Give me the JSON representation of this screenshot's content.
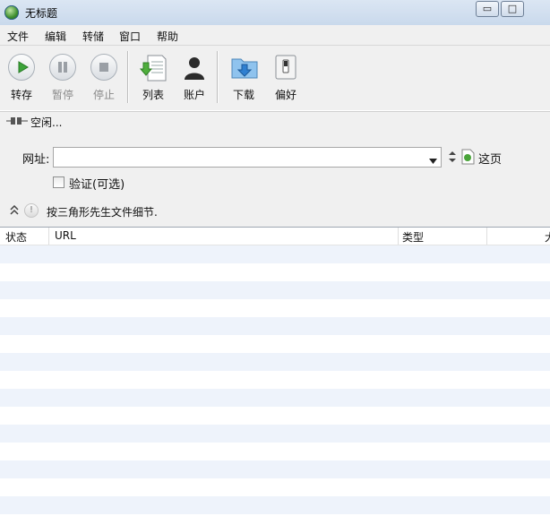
{
  "window": {
    "title": "无标题",
    "minimize_glyph": "▭",
    "maximize_glyph": "□"
  },
  "menu": [
    "文件",
    "编辑",
    "转储",
    "窗口",
    "帮助"
  ],
  "toolbar": {
    "start": "转存",
    "pause": "暂停",
    "stop": "停止",
    "list": "列表",
    "account": "账户",
    "download": "下载",
    "prefs": "偏好"
  },
  "status": {
    "text": "空闲..."
  },
  "form": {
    "url_label": "网址:",
    "url_value": "",
    "this_page": "这页",
    "verify_label": "验证(可选)",
    "hint": "按三角形先生文件细节."
  },
  "table": {
    "columns": [
      "状态",
      "URL",
      "类型",
      "大"
    ]
  },
  "colors": {
    "row_alt": "#eef3fb",
    "titlebar": "#c9d9ec"
  }
}
